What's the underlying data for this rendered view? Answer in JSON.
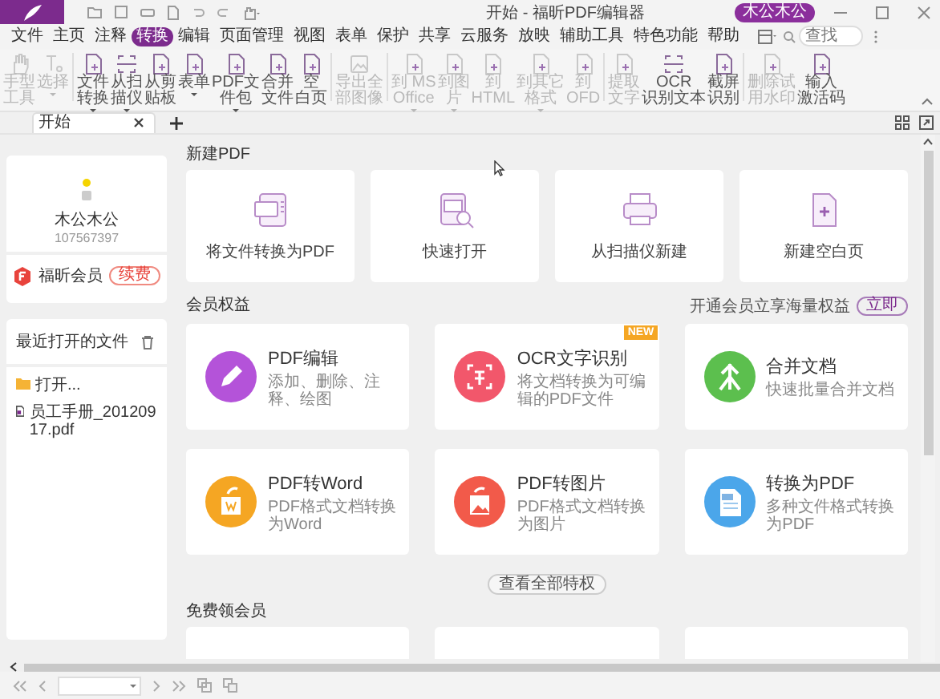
{
  "title_bar": {
    "title": "开始 - 福昕PDF编辑器",
    "user": "木公木公"
  },
  "menu": [
    {
      "label": "文件",
      "selected": false
    },
    {
      "label": "主页",
      "selected": false
    },
    {
      "label": "注释",
      "selected": false
    },
    {
      "label": "转换",
      "selected": true
    },
    {
      "label": "编辑",
      "selected": false
    },
    {
      "label": "页面管理",
      "selected": false
    },
    {
      "label": "视图",
      "selected": false
    },
    {
      "label": "表单",
      "selected": false
    },
    {
      "label": "保护",
      "selected": false
    },
    {
      "label": "共享",
      "selected": false
    },
    {
      "label": "云服务",
      "selected": false
    },
    {
      "label": "放映",
      "selected": false
    },
    {
      "label": "辅助工具",
      "selected": false
    },
    {
      "label": "特色功能",
      "selected": false
    },
    {
      "label": "帮助",
      "selected": false
    }
  ],
  "search": {
    "placeholder": "查找"
  },
  "ribbon": [
    {
      "tools": [
        {
          "lines": [
            "手型",
            "工具"
          ],
          "kind": "hand",
          "disabled": true,
          "dropdown": false
        },
        {
          "lines": [
            "选择"
          ],
          "kind": "select",
          "disabled": true,
          "dropdown": true
        }
      ]
    },
    {
      "tools": [
        {
          "lines": [
            "文件",
            "转换"
          ],
          "kind": "page",
          "disabled": false,
          "dropdown": true
        },
        {
          "lines": [
            "从扫",
            "描仪"
          ],
          "kind": "scan",
          "disabled": false,
          "dropdown": true
        },
        {
          "lines": [
            "从剪",
            "贴板"
          ],
          "kind": "page",
          "disabled": false,
          "dropdown": false
        },
        {
          "lines": [
            "表单"
          ],
          "kind": "page",
          "disabled": false,
          "dropdown": true
        },
        {
          "lines": [
            "PDF文",
            "件包"
          ],
          "kind": "page",
          "disabled": false,
          "dropdown": true
        },
        {
          "lines": [
            "合并",
            "文件"
          ],
          "kind": "page",
          "disabled": false,
          "dropdown": false
        },
        {
          "lines": [
            "空",
            "白页"
          ],
          "kind": "page",
          "disabled": false,
          "dropdown": false
        }
      ]
    },
    {
      "tools": [
        {
          "lines": [
            "导出全",
            "部图像"
          ],
          "kind": "image",
          "disabled": true,
          "dropdown": false
        }
      ]
    },
    {
      "tools": [
        {
          "lines": [
            "到 MS",
            "Office"
          ],
          "kind": "page",
          "disabled": true,
          "dropdown": true
        },
        {
          "lines": [
            "到图",
            "片"
          ],
          "kind": "page",
          "disabled": true,
          "dropdown": true
        },
        {
          "lines": [
            "到",
            "HTML"
          ],
          "kind": "page",
          "disabled": true,
          "dropdown": false
        },
        {
          "lines": [
            "到其它",
            "格式"
          ],
          "kind": "page",
          "disabled": true,
          "dropdown": true
        },
        {
          "lines": [
            "到",
            "OFD"
          ],
          "kind": "page",
          "disabled": true,
          "dropdown": false
        }
      ]
    },
    {
      "tools": [
        {
          "lines": [
            "提取",
            "文字"
          ],
          "kind": "page",
          "disabled": true,
          "dropdown": false
        },
        {
          "lines": [
            "OCR",
            "识别文本"
          ],
          "kind": "scan",
          "disabled": false,
          "dropdown": false
        },
        {
          "lines": [
            "截屏",
            "识别"
          ],
          "kind": "page",
          "disabled": false,
          "dropdown": false
        }
      ]
    },
    {
      "tools": [
        {
          "lines": [
            "删除试",
            "用水印"
          ],
          "kind": "page",
          "disabled": true,
          "dropdown": false
        },
        {
          "lines": [
            "输入",
            "激活码"
          ],
          "kind": "page",
          "disabled": false,
          "dropdown": false
        }
      ]
    }
  ],
  "doc_tabs": [
    {
      "label": "开始",
      "selected": true
    }
  ],
  "user_card": {
    "name": "木公木公",
    "id": "107567397",
    "membership": "福昕会员",
    "renew": "续费"
  },
  "recent": {
    "title": "最近打开的文件",
    "items": [
      {
        "kind": "folder",
        "label": "打开..."
      },
      {
        "kind": "pdf",
        "label": "员工手册_20120917.pdf"
      }
    ]
  },
  "new_pdf": {
    "title": "新建PDF",
    "cards": [
      {
        "label": "将文件转换为PDF",
        "kind": "convert"
      },
      {
        "label": "快速打开",
        "kind": "open"
      },
      {
        "label": "从扫描仪新建",
        "kind": "scan"
      },
      {
        "label": "新建空白页",
        "kind": "blank"
      }
    ]
  },
  "benefits": {
    "title": "会员权益",
    "promo": "开通会员立享海量权益",
    "promo_button": "立即",
    "cards": [
      {
        "title": "PDF编辑",
        "desc": "添加、删除、注释、绘图",
        "color": "#b453d9",
        "kind": "pencil"
      },
      {
        "title": "OCR文字识别",
        "desc": "将文档转换为可编辑的PDF文件",
        "color": "#f2576b",
        "kind": "ocr",
        "badge": "NEW"
      },
      {
        "title": "合并文档",
        "desc": "快速批量合并文档",
        "color": "#5cbf4e",
        "kind": "merge"
      },
      {
        "title": "PDF转Word",
        "desc": "PDF格式文档转换为Word",
        "color": "#f5a623",
        "kind": "word"
      },
      {
        "title": "PDF转图片",
        "desc": "PDF格式文档转换为图片",
        "color": "#f25a4a",
        "kind": "image"
      },
      {
        "title": "转换为PDF",
        "desc": "多种文件格式转换为PDF",
        "color": "#4ba6ea",
        "kind": "topdf"
      }
    ],
    "more": "查看全部特权"
  },
  "free": {
    "title": "免费领会员"
  }
}
